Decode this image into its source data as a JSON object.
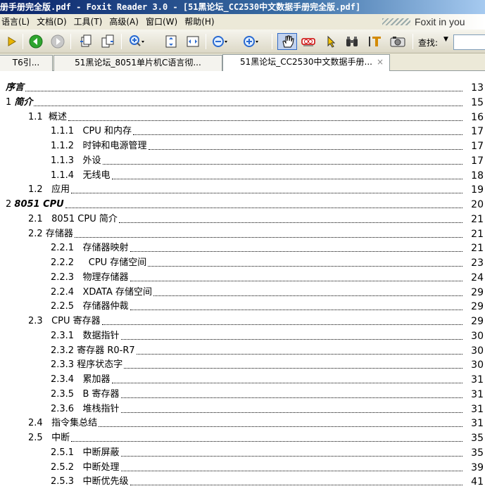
{
  "window": {
    "title": "册手册完全版.pdf - Foxit Reader 3.0 - [51黑论坛_CC2530中文数据手册完全版.pdf]",
    "brand": "Foxit in you"
  },
  "menu": [
    "语言(L)",
    "文档(D)",
    "工具(T)",
    "高级(A)",
    "窗口(W)",
    "帮助(H)"
  ],
  "toolbar": {
    "find_label": "查找:",
    "find_value": "",
    "icons": [
      "play-icon",
      "back-icon",
      "forward-icon",
      "page-single-icon",
      "page-double-icon",
      "zoom-in-icon",
      "fit-page-icon",
      "fit-width-icon",
      "zoom-out-icon",
      "zoom-plus-icon",
      "hand-tool-icon",
      "typewriter-icon",
      "select-arrow-icon",
      "binoculars-icon",
      "text-select-icon",
      "snapshot-icon"
    ]
  },
  "tabs": [
    {
      "label": "T6引...",
      "active": false
    },
    {
      "label": "51黑论坛_8051单片机C语言彻...",
      "active": false
    },
    {
      "label": "51黑论坛_CC2530中文数据手册...",
      "active": true,
      "close": "×"
    }
  ],
  "toc": [
    {
      "num": "",
      "label": "序言",
      "page": "13",
      "level": 0,
      "style": "bi"
    },
    {
      "num": "1 ",
      "label": "简介",
      "page": "15",
      "level": 0,
      "style": "bi"
    },
    {
      "num": "1.1  ",
      "label": "概述",
      "page": "16",
      "level": 1
    },
    {
      "num": "1.1.1   ",
      "label": "CPU 和内存",
      "page": "17",
      "level": 2
    },
    {
      "num": "1.1.2   ",
      "label": "时钟和电源管理",
      "page": "17",
      "level": 2
    },
    {
      "num": "1.1.3   ",
      "label": "外设",
      "page": "17",
      "level": 2
    },
    {
      "num": "1.1.4   ",
      "label": "无线电",
      "page": "18",
      "level": 2
    },
    {
      "num": "1.2   ",
      "label": "应用",
      "page": "19",
      "level": 1
    },
    {
      "num": "2 ",
      "label": "8051 CPU",
      "page": "20",
      "level": 0,
      "style": "bi"
    },
    {
      "num": "2.1   ",
      "label": "8051 CPU 简介",
      "page": "21",
      "level": 1
    },
    {
      "num": "2.2 ",
      "label": "存储器",
      "page": "21",
      "level": 1
    },
    {
      "num": "2.2.1   ",
      "label": "存储器映射",
      "page": "21",
      "level": 2
    },
    {
      "num": "2.2.2    ",
      "label": " CPU 存储空间",
      "page": "23",
      "level": 2
    },
    {
      "num": "2.2.3   ",
      "label": "物理存储器",
      "page": "24",
      "level": 2
    },
    {
      "num": "2.2.4   ",
      "label": "XDATA 存储空间",
      "page": "29",
      "level": 2
    },
    {
      "num": "2.2.5   ",
      "label": "存储器仲裁",
      "page": "29",
      "level": 2
    },
    {
      "num": "2.3   ",
      "label": "CPU 寄存器",
      "page": "29",
      "level": 1
    },
    {
      "num": "2.3.1   ",
      "label": "数据指针",
      "page": "30",
      "level": 2
    },
    {
      "num": "2.3.2 ",
      "label": "寄存器 R0-R7",
      "page": "30",
      "level": 2
    },
    {
      "num": "2.3.3 ",
      "label": "程序状态字",
      "page": "30",
      "level": 2
    },
    {
      "num": "2.3.4   ",
      "label": "累加器",
      "page": "31",
      "level": 2
    },
    {
      "num": "2.3.5   ",
      "label": "B 寄存器",
      "page": "31",
      "level": 2
    },
    {
      "num": "2.3.6   ",
      "label": "堆栈指针",
      "page": "31",
      "level": 2
    },
    {
      "num": "2.4   ",
      "label": "指令集总结",
      "page": "31",
      "level": 1
    },
    {
      "num": "2.5   ",
      "label": "中断",
      "page": "35",
      "level": 1
    },
    {
      "num": "2.5.1   ",
      "label": "中断屏蔽",
      "page": "35",
      "level": 2
    },
    {
      "num": "2.5.2   ",
      "label": "中断处理",
      "page": "39",
      "level": 2
    },
    {
      "num": "2.5.3   ",
      "label": "中断优先级",
      "page": "41",
      "level": 2
    }
  ]
}
